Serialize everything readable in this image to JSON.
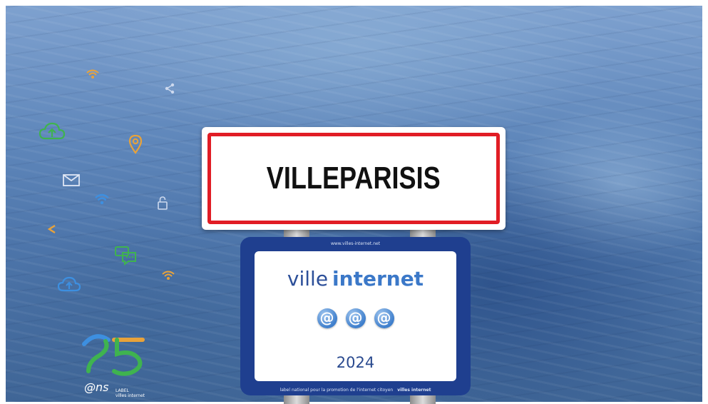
{
  "town_sign": {
    "name": "VILLEPARISIS",
    "border_color": "#e11d25"
  },
  "label_sign": {
    "url": "www.villes-internet.net",
    "brand_word1": "ville",
    "brand_word2": "internet",
    "rating_symbol": "@",
    "rating_count": 3,
    "year": "2024",
    "footer": "label national pour la promotion de l'internet citoyen",
    "footer_logo": "villes internet",
    "background_color": "#1f3f8f"
  },
  "logo": {
    "ans_text": "@ns",
    "label_line1": "LABEL",
    "label_line2": "villes internet"
  },
  "icons": [
    "wifi-icon",
    "share-icon",
    "cloud-upload-icon",
    "location-pin-icon",
    "mail-icon",
    "wifi-icon",
    "lock-icon",
    "share-icon",
    "chat-icon",
    "wifi-icon",
    "cloud-upload-icon"
  ]
}
